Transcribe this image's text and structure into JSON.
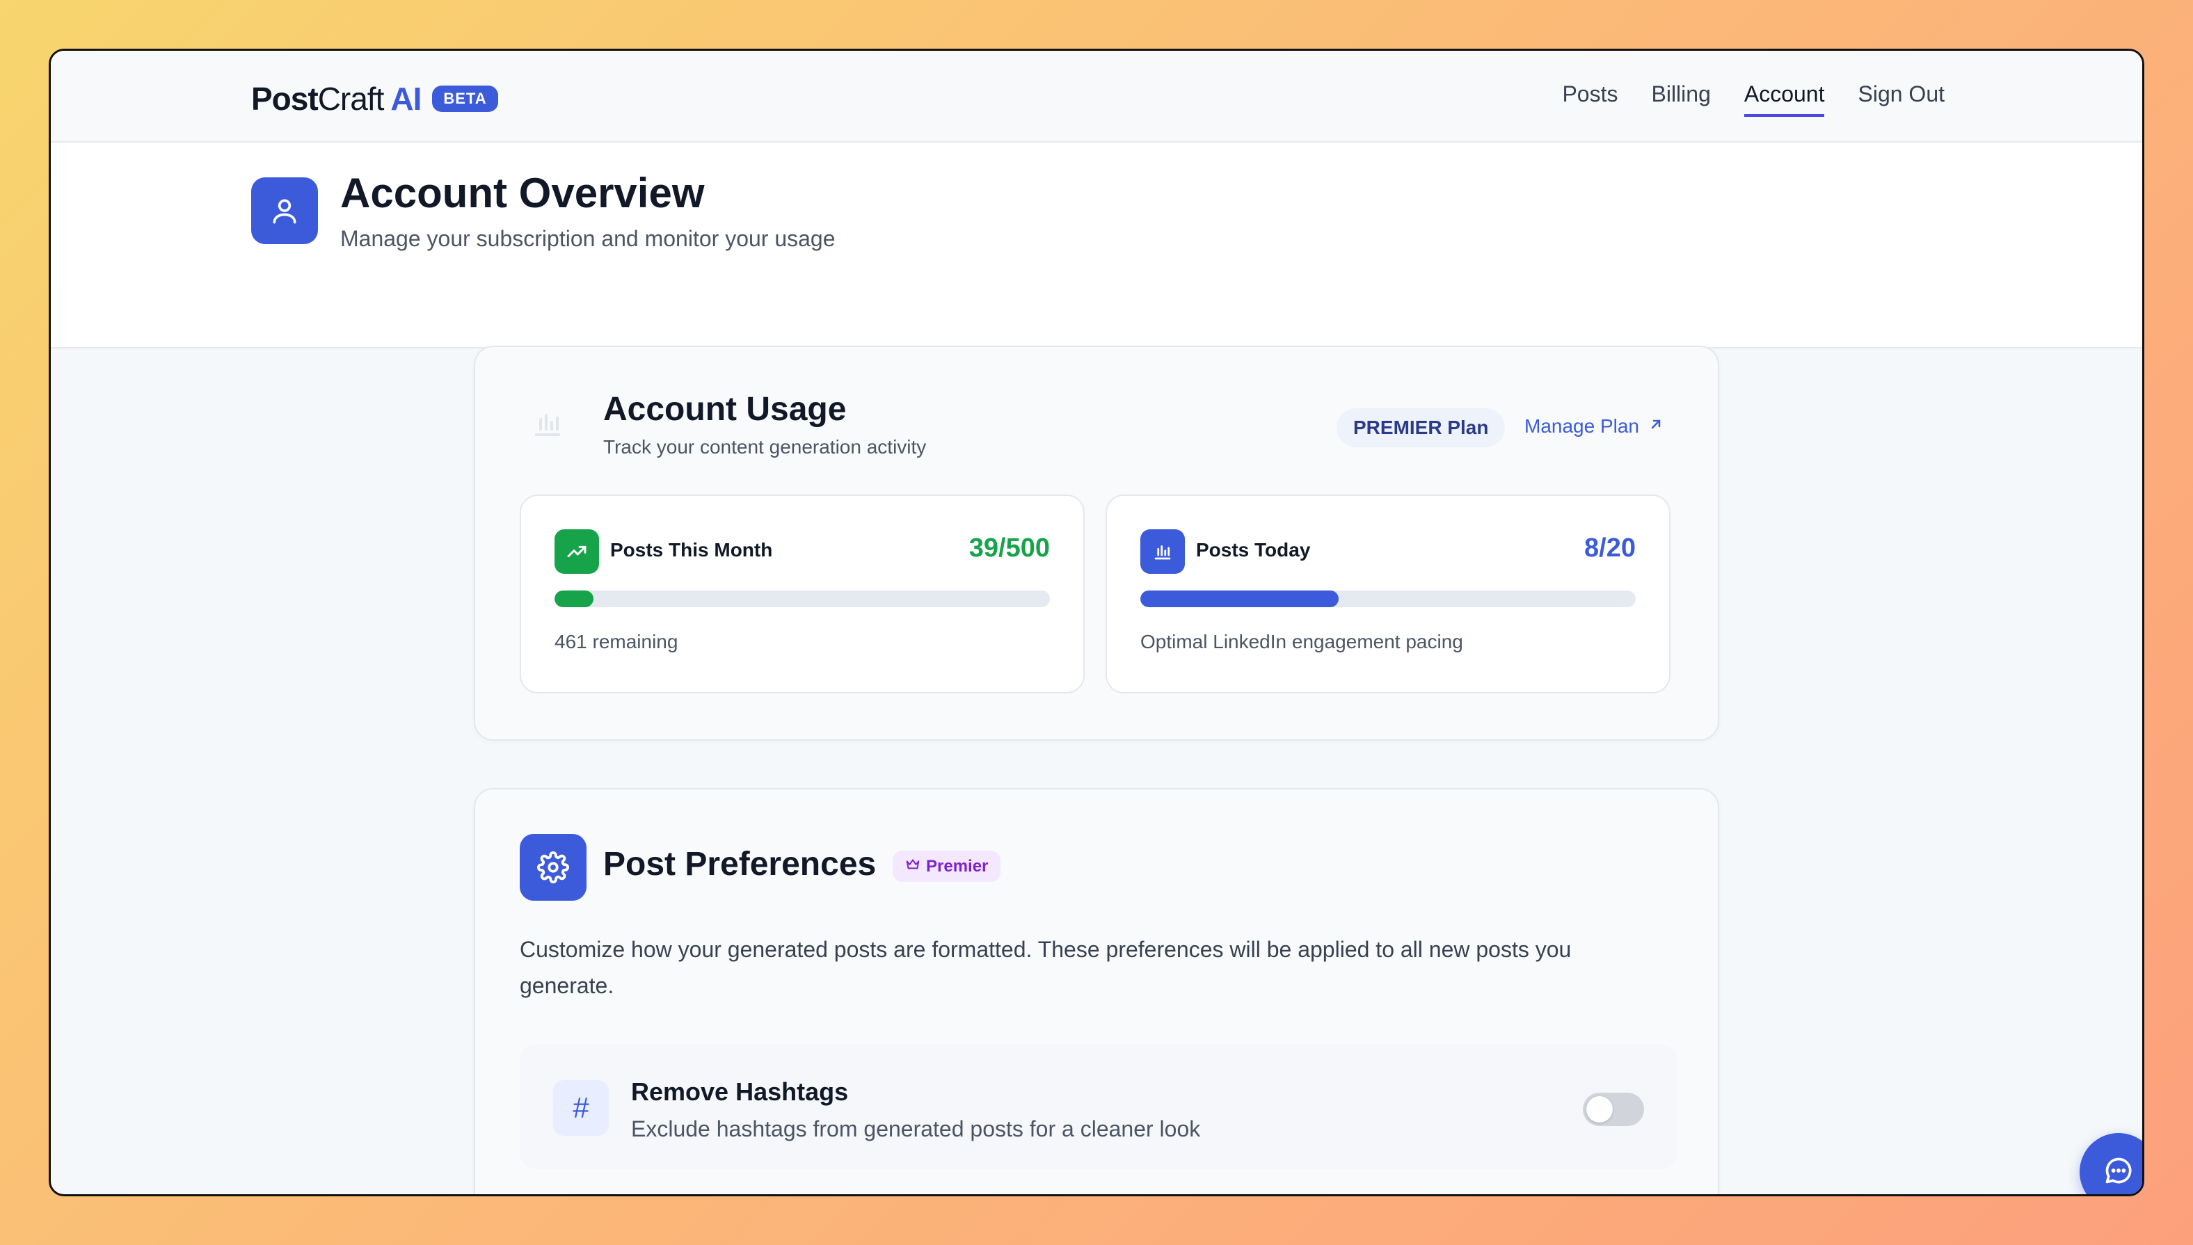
{
  "brand": {
    "name_bold": "Post",
    "name_light": "Craft",
    "name_ai": "AI",
    "badge": "BETA"
  },
  "nav": {
    "items": [
      {
        "label": "Posts"
      },
      {
        "label": "Billing"
      },
      {
        "label": "Account"
      },
      {
        "label": "Sign Out"
      }
    ],
    "active": "Account"
  },
  "header": {
    "title": "Account Overview",
    "subtitle": "Manage your subscription and monitor your usage",
    "icon": "user-icon"
  },
  "usage": {
    "title": "Account Usage",
    "subtitle": "Track your content generation activity",
    "plan_badge": "PREMIER Plan",
    "manage_label": "Manage Plan",
    "stats": [
      {
        "label": "Posts This Month",
        "value": "39/500",
        "used": 39,
        "limit": 500,
        "note": "461 remaining",
        "icon": "trending-up-icon",
        "color": "#16a34a"
      },
      {
        "label": "Posts Today",
        "value": "8/20",
        "used": 8,
        "limit": 20,
        "note": "Optimal LinkedIn engagement pacing",
        "icon": "bar-chart-icon",
        "color": "#3b5bdb"
      }
    ]
  },
  "preferences": {
    "title": "Post Preferences",
    "badge": "Premier",
    "description": "Customize how your generated posts are formatted. These preferences will be applied to all new posts you generate.",
    "options": [
      {
        "title": "Remove Hashtags",
        "subtitle": "Exclude hashtags from generated posts for a cleaner look",
        "icon": "hash-icon",
        "enabled": false
      }
    ]
  },
  "colors": {
    "accent": "#3b5bdb",
    "success": "#16a34a",
    "premium": "#7e22ce"
  }
}
